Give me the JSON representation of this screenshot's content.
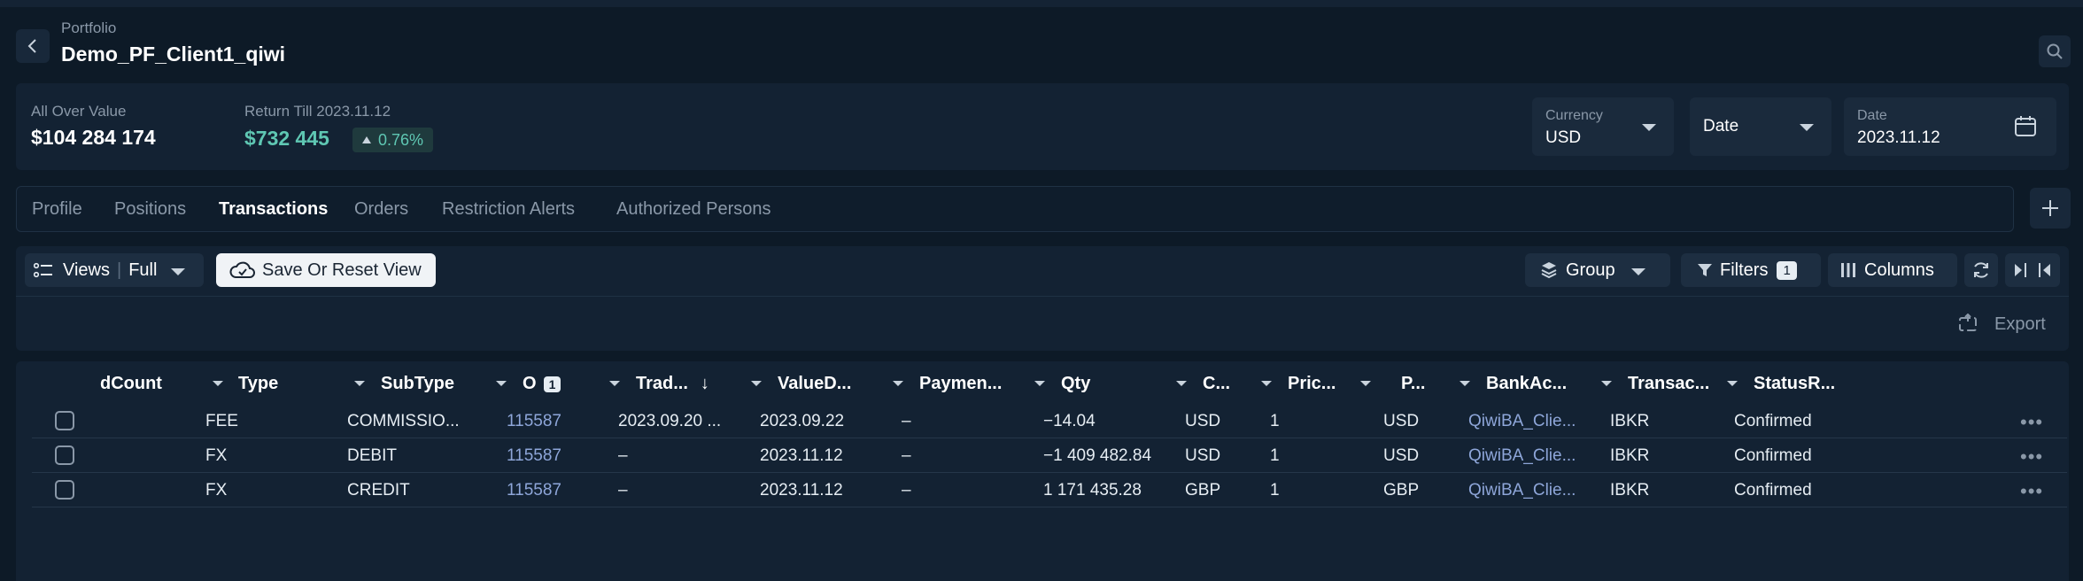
{
  "header": {
    "breadcrumb": "Portfolio",
    "title": "Demo_PF_Client1_qiwi"
  },
  "summary": {
    "overall_label": "All Over Value",
    "overall_value": "$104 284 174",
    "return_label": "Return Till 2023.11.12",
    "return_value": "$732 445",
    "return_pct": "0.76%",
    "currency_label": "Currency",
    "currency_value": "USD",
    "date_select": "Date",
    "date_label": "Date",
    "date_value": "2023.11.12"
  },
  "tabs": [
    "Profile",
    "Positions",
    "Transactions",
    "Orders",
    "Restriction Alerts",
    "Authorized Persons"
  ],
  "active_tab": "Transactions",
  "toolbar": {
    "views_label": "Views",
    "views_value": "Full",
    "save_reset": "Save Or Reset View",
    "group": "Group",
    "filters": "Filters",
    "filters_count": "1",
    "columns": "Columns",
    "export": "Export"
  },
  "table": {
    "headers": [
      "dCount",
      "Type",
      "SubType",
      "O",
      "Trad...",
      "ValueD...",
      "Paymen...",
      "Qty",
      "C...",
      "Pric...",
      "P...",
      "BankAc...",
      "Transac...",
      "StatusR..."
    ],
    "o_badge": "1",
    "sort_arrow": "↓",
    "rows": [
      [
        "FEE",
        "COMMISSIO...",
        "115587",
        "2023.09.20 ...",
        "2023.09.22",
        "–",
        "−14.04",
        "USD",
        "1",
        "USD",
        "QiwiBA_Clie...",
        "IBKR",
        "Confirmed"
      ],
      [
        "FX",
        "DEBIT",
        "115587",
        "–",
        "2023.11.12",
        "–",
        "−1 409 482.84",
        "USD",
        "1",
        "USD",
        "QiwiBA_Clie...",
        "IBKR",
        "Confirmed"
      ],
      [
        "FX",
        "CREDIT",
        "115587",
        "–",
        "2023.11.12",
        "–",
        "1 171 435.28",
        "GBP",
        "1",
        "GBP",
        "QiwiBA_Clie...",
        "IBKR",
        "Confirmed"
      ]
    ]
  },
  "colors": {
    "background": "#0d1a27",
    "panel": "#132233",
    "accent_return": "#5fc7b3",
    "link": "#8ea6d9"
  }
}
